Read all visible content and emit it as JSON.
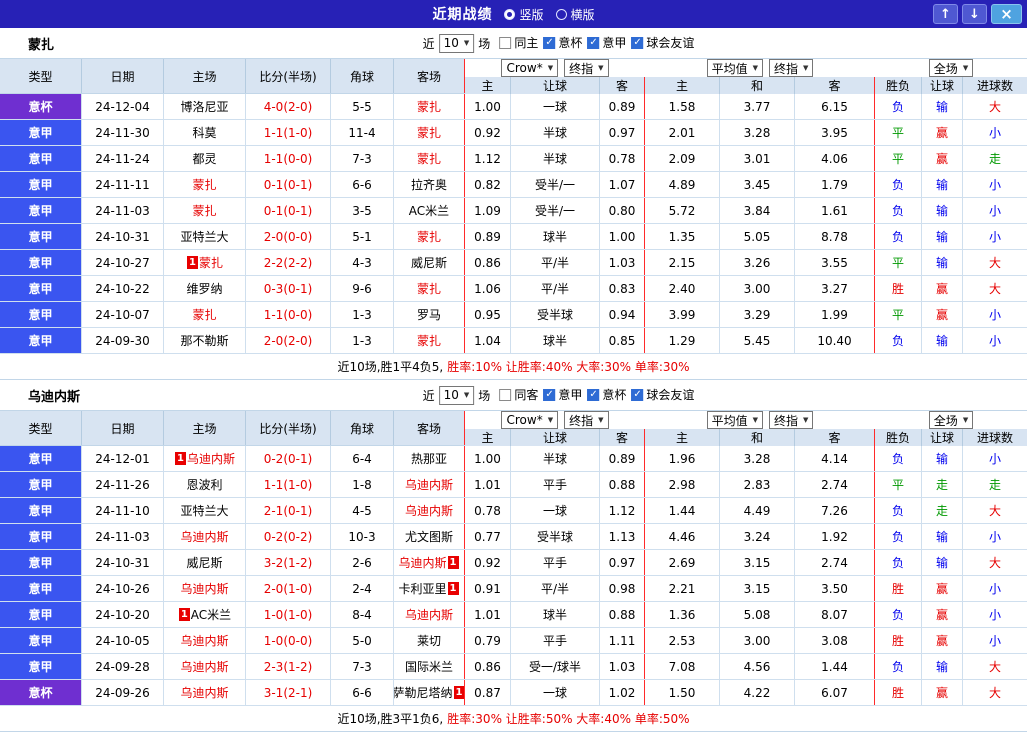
{
  "titlebar": {
    "title": "近期战绩",
    "view_options": [
      {
        "label": "竖版",
        "selected": true
      },
      {
        "label": "横版",
        "selected": false
      }
    ],
    "buttons": {
      "up": "↑",
      "down": "↓",
      "close": "×"
    }
  },
  "labels": {
    "near": "近",
    "games": "场",
    "dropdown_arrow": "▼"
  },
  "columns": [
    "类型",
    "日期",
    "主场",
    "比分(半场)",
    "角球",
    "客场",
    "主",
    "让球",
    "客",
    "主",
    "和",
    "客",
    "胜负",
    "让球",
    "进球数"
  ],
  "colors": {
    "titlebar_bg": "#2721b6",
    "league_badge_bg": "#3a55f0",
    "cup_badge_bg": "#6f2fd0",
    "header_bg": "#d8e4f2",
    "focus_team": "#e60000",
    "score": "#e60000",
    "win": "#e60000",
    "draw": "#009900",
    "loss": "#0000ee",
    "group_divider": "#ff2a2a",
    "red_card_badge": "#e80000"
  },
  "sections": [
    {
      "team": "蒙扎",
      "filter": {
        "games": "10",
        "checkboxes": [
          {
            "label": "同主",
            "checked": false
          },
          {
            "label": "意杯",
            "checked": true
          },
          {
            "label": "意甲",
            "checked": true
          },
          {
            "label": "球会友谊",
            "checked": true
          }
        ]
      },
      "dropdowns": {
        "ah_source": "Crow*",
        "ah_time": "终指",
        "eu_source": "平均值",
        "eu_time": "终指",
        "scope": "全场"
      },
      "rows": [
        {
          "league": "意杯",
          "type": "cup",
          "date": "24-12-04",
          "home": "博洛尼亚",
          "home_card": "",
          "home_focus": false,
          "score": "4-0(2-0)",
          "corners": "5-5",
          "away": "蒙扎",
          "away_card": "",
          "away_focus": true,
          "ah": [
            "1.00",
            "一球",
            "0.89"
          ],
          "eu": [
            "1.58",
            "3.77",
            "6.15"
          ],
          "result": "负",
          "ah_result": "输",
          "goals": "大"
        },
        {
          "league": "意甲",
          "type": "league",
          "date": "24-11-30",
          "home": "科莫",
          "home_card": "",
          "home_focus": false,
          "score": "1-1(1-0)",
          "corners": "11-4",
          "away": "蒙扎",
          "away_card": "",
          "away_focus": true,
          "ah": [
            "0.92",
            "半球",
            "0.97"
          ],
          "eu": [
            "2.01",
            "3.28",
            "3.95"
          ],
          "result": "平",
          "ah_result": "赢",
          "goals": "小"
        },
        {
          "league": "意甲",
          "type": "league",
          "date": "24-11-24",
          "home": "都灵",
          "home_card": "",
          "home_focus": false,
          "score": "1-1(0-0)",
          "corners": "7-3",
          "away": "蒙扎",
          "away_card": "",
          "away_focus": true,
          "ah": [
            "1.12",
            "半球",
            "0.78"
          ],
          "eu": [
            "2.09",
            "3.01",
            "4.06"
          ],
          "result": "平",
          "ah_result": "赢",
          "goals": "走"
        },
        {
          "league": "意甲",
          "type": "league",
          "date": "24-11-11",
          "home": "蒙扎",
          "home_card": "",
          "home_focus": true,
          "score": "0-1(0-1)",
          "corners": "6-6",
          "away": "拉齐奥",
          "away_card": "",
          "away_focus": false,
          "ah": [
            "0.82",
            "受半/一",
            "1.07"
          ],
          "eu": [
            "4.89",
            "3.45",
            "1.79"
          ],
          "result": "负",
          "ah_result": "输",
          "goals": "小"
        },
        {
          "league": "意甲",
          "type": "league",
          "date": "24-11-03",
          "home": "蒙扎",
          "home_card": "",
          "home_focus": true,
          "score": "0-1(0-1)",
          "corners": "3-5",
          "away": "AC米兰",
          "away_card": "",
          "away_focus": false,
          "ah": [
            "1.09",
            "受半/一",
            "0.80"
          ],
          "eu": [
            "5.72",
            "3.84",
            "1.61"
          ],
          "result": "负",
          "ah_result": "输",
          "goals": "小"
        },
        {
          "league": "意甲",
          "type": "league",
          "date": "24-10-31",
          "home": "亚特兰大",
          "home_card": "",
          "home_focus": false,
          "score": "2-0(0-0)",
          "corners": "5-1",
          "away": "蒙扎",
          "away_card": "",
          "away_focus": true,
          "ah": [
            "0.89",
            "球半",
            "1.00"
          ],
          "eu": [
            "1.35",
            "5.05",
            "8.78"
          ],
          "result": "负",
          "ah_result": "输",
          "goals": "小"
        },
        {
          "league": "意甲",
          "type": "league",
          "date": "24-10-27",
          "home": "蒙扎",
          "home_card": "1",
          "home_focus": true,
          "score": "2-2(2-2)",
          "corners": "4-3",
          "away": "威尼斯",
          "away_card": "",
          "away_focus": false,
          "ah": [
            "0.86",
            "平/半",
            "1.03"
          ],
          "eu": [
            "2.15",
            "3.26",
            "3.55"
          ],
          "result": "平",
          "ah_result": "输",
          "goals": "大"
        },
        {
          "league": "意甲",
          "type": "league",
          "date": "24-10-22",
          "home": "维罗纳",
          "home_card": "",
          "home_focus": false,
          "score": "0-3(0-1)",
          "corners": "9-6",
          "away": "蒙扎",
          "away_card": "",
          "away_focus": true,
          "ah": [
            "1.06",
            "平/半",
            "0.83"
          ],
          "eu": [
            "2.40",
            "3.00",
            "3.27"
          ],
          "result": "胜",
          "ah_result": "赢",
          "goals": "大"
        },
        {
          "league": "意甲",
          "type": "league",
          "date": "24-10-07",
          "home": "蒙扎",
          "home_card": "",
          "home_focus": true,
          "score": "1-1(0-0)",
          "corners": "1-3",
          "away": "罗马",
          "away_card": "",
          "away_focus": false,
          "ah": [
            "0.95",
            "受半球",
            "0.94"
          ],
          "eu": [
            "3.99",
            "3.29",
            "1.99"
          ],
          "result": "平",
          "ah_result": "赢",
          "goals": "小"
        },
        {
          "league": "意甲",
          "type": "league",
          "date": "24-09-30",
          "home": "那不勒斯",
          "home_card": "",
          "home_focus": false,
          "score": "2-0(2-0)",
          "corners": "1-3",
          "away": "蒙扎",
          "away_card": "",
          "away_focus": true,
          "ah": [
            "1.04",
            "球半",
            "0.85"
          ],
          "eu": [
            "1.29",
            "5.45",
            "10.40"
          ],
          "result": "负",
          "ah_result": "输",
          "goals": "小"
        }
      ],
      "summary": {
        "record": "近10场,胜1平4负5,",
        "stats": "胜率:10% 让胜率:40% 大率:30% 单率:30%"
      }
    },
    {
      "team": "乌迪内斯",
      "filter": {
        "games": "10",
        "checkboxes": [
          {
            "label": "同客",
            "checked": false
          },
          {
            "label": "意甲",
            "checked": true
          },
          {
            "label": "意杯",
            "checked": true
          },
          {
            "label": "球会友谊",
            "checked": true
          }
        ]
      },
      "dropdowns": {
        "ah_source": "Crow*",
        "ah_time": "终指",
        "eu_source": "平均值",
        "eu_time": "终指",
        "scope": "全场"
      },
      "rows": [
        {
          "league": "意甲",
          "type": "league",
          "date": "24-12-01",
          "home": "乌迪内斯",
          "home_card": "1",
          "home_focus": true,
          "score": "0-2(0-1)",
          "corners": "6-4",
          "away": "热那亚",
          "away_card": "",
          "away_focus": false,
          "ah": [
            "1.00",
            "半球",
            "0.89"
          ],
          "eu": [
            "1.96",
            "3.28",
            "4.14"
          ],
          "result": "负",
          "ah_result": "输",
          "goals": "小"
        },
        {
          "league": "意甲",
          "type": "league",
          "date": "24-11-26",
          "home": "恩波利",
          "home_card": "",
          "home_focus": false,
          "score": "1-1(1-0)",
          "corners": "1-8",
          "away": "乌迪内斯",
          "away_card": "",
          "away_focus": true,
          "ah": [
            "1.01",
            "平手",
            "0.88"
          ],
          "eu": [
            "2.98",
            "2.83",
            "2.74"
          ],
          "result": "平",
          "ah_result": "走",
          "goals": "走"
        },
        {
          "league": "意甲",
          "type": "league",
          "date": "24-11-10",
          "home": "亚特兰大",
          "home_card": "",
          "home_focus": false,
          "score": "2-1(0-1)",
          "corners": "4-5",
          "away": "乌迪内斯",
          "away_card": "",
          "away_focus": true,
          "ah": [
            "0.78",
            "一球",
            "1.12"
          ],
          "eu": [
            "1.44",
            "4.49",
            "7.26"
          ],
          "result": "负",
          "ah_result": "走",
          "goals": "大"
        },
        {
          "league": "意甲",
          "type": "league",
          "date": "24-11-03",
          "home": "乌迪内斯",
          "home_card": "",
          "home_focus": true,
          "score": "0-2(0-2)",
          "corners": "10-3",
          "away": "尤文图斯",
          "away_card": "",
          "away_focus": false,
          "ah": [
            "0.77",
            "受半球",
            "1.13"
          ],
          "eu": [
            "4.46",
            "3.24",
            "1.92"
          ],
          "result": "负",
          "ah_result": "输",
          "goals": "小"
        },
        {
          "league": "意甲",
          "type": "league",
          "date": "24-10-31",
          "home": "威尼斯",
          "home_card": "",
          "home_focus": false,
          "score": "3-2(1-2)",
          "corners": "2-6",
          "away": "乌迪内斯",
          "away_card": "1",
          "away_focus": true,
          "ah": [
            "0.92",
            "平手",
            "0.97"
          ],
          "eu": [
            "2.69",
            "3.15",
            "2.74"
          ],
          "result": "负",
          "ah_result": "输",
          "goals": "大"
        },
        {
          "league": "意甲",
          "type": "league",
          "date": "24-10-26",
          "home": "乌迪内斯",
          "home_card": "",
          "home_focus": true,
          "score": "2-0(1-0)",
          "corners": "2-4",
          "away": "卡利亚里",
          "away_card": "1",
          "away_focus": false,
          "ah": [
            "0.91",
            "平/半",
            "0.98"
          ],
          "eu": [
            "2.21",
            "3.15",
            "3.50"
          ],
          "result": "胜",
          "ah_result": "赢",
          "goals": "小"
        },
        {
          "league": "意甲",
          "type": "league",
          "date": "24-10-20",
          "home": "AC米兰",
          "home_card": "1",
          "home_focus": false,
          "score": "1-0(1-0)",
          "corners": "8-4",
          "away": "乌迪内斯",
          "away_card": "",
          "away_focus": true,
          "ah": [
            "1.01",
            "球半",
            "0.88"
          ],
          "eu": [
            "1.36",
            "5.08",
            "8.07"
          ],
          "result": "负",
          "ah_result": "赢",
          "goals": "小"
        },
        {
          "league": "意甲",
          "type": "league",
          "date": "24-10-05",
          "home": "乌迪内斯",
          "home_card": "",
          "home_focus": true,
          "score": "1-0(0-0)",
          "corners": "5-0",
          "away": "莱切",
          "away_card": "",
          "away_focus": false,
          "ah": [
            "0.79",
            "平手",
            "1.11"
          ],
          "eu": [
            "2.53",
            "3.00",
            "3.08"
          ],
          "result": "胜",
          "ah_result": "赢",
          "goals": "小"
        },
        {
          "league": "意甲",
          "type": "league",
          "date": "24-09-28",
          "home": "乌迪内斯",
          "home_card": "",
          "home_focus": true,
          "score": "2-3(1-2)",
          "corners": "7-3",
          "away": "国际米兰",
          "away_card": "",
          "away_focus": false,
          "ah": [
            "0.86",
            "受一/球半",
            "1.03"
          ],
          "eu": [
            "7.08",
            "4.56",
            "1.44"
          ],
          "result": "负",
          "ah_result": "输",
          "goals": "大"
        },
        {
          "league": "意杯",
          "type": "cup",
          "date": "24-09-26",
          "home": "乌迪内斯",
          "home_card": "",
          "home_focus": true,
          "score": "3-1(2-1)",
          "corners": "6-6",
          "away": "萨勒尼塔纳",
          "away_card": "1",
          "away_focus": false,
          "ah": [
            "0.87",
            "一球",
            "1.02"
          ],
          "eu": [
            "1.50",
            "4.22",
            "6.07"
          ],
          "result": "胜",
          "ah_result": "赢",
          "goals": "大"
        }
      ],
      "summary": {
        "record": "近10场,胜3平1负6,",
        "stats": "胜率:30% 让胜率:50% 大率:40% 单率:50%"
      }
    }
  ]
}
